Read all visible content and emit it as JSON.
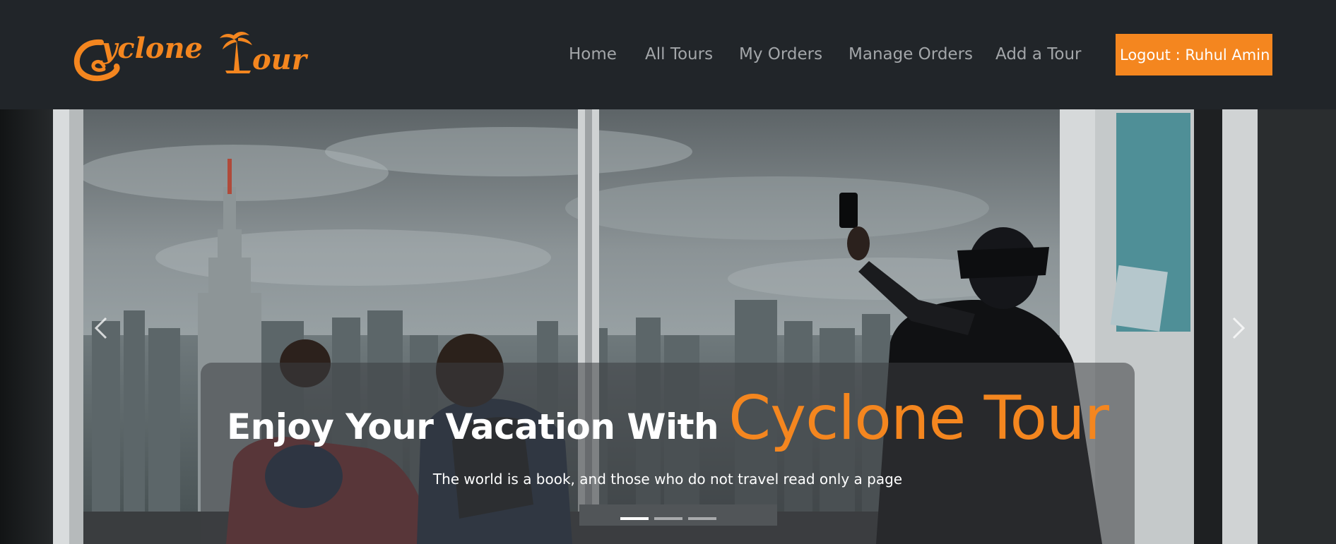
{
  "brand": {
    "name_part1": "yclone",
    "name_part2": "our",
    "accent_color": "#f4861f"
  },
  "nav": {
    "items": [
      {
        "label": "Home"
      },
      {
        "label": "All Tours"
      },
      {
        "label": "My Orders"
      },
      {
        "label": "Manage Orders"
      },
      {
        "label": "Add a Tour"
      }
    ],
    "logout_label": "Logout : Ruhul Amin"
  },
  "hero": {
    "title_lead": "Enjoy Your Vacation With",
    "title_brand": "Cyclone Tour",
    "subtitle": "The world is a book, and those who do not travel read only a page",
    "active_slide": 1,
    "slide_count": 3,
    "prev_icon": "chevron-left-icon",
    "next_icon": "chevron-right-icon"
  },
  "colors": {
    "navbar_bg": "#212529",
    "nav_link": "#a3a6a9",
    "accent": "#f4861f",
    "text_light": "#ffffff"
  }
}
